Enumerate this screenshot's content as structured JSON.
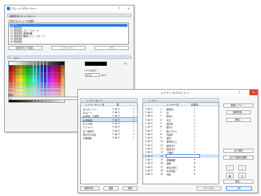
{
  "colors": {
    "accent": "#2f7fe0",
    "header_bg": "#dbe3ee",
    "close_red": "#e0413b",
    "row_selected": "#cfe3fb"
  },
  "win1": {
    "title": "パレットマネージャー",
    "help": "?",
    "close": "×",
    "section1": "画像形状パレットセット",
    "list_label": "下記からパレットを選択",
    "items": [
      "モデル",
      "01 電気設計",
      "02 電気設計_グレースケール",
      "03 電気設計_機械設備",
      "04 電気設計(機械)_グレースケール",
      "05 電気設計",
      "06 電気設計"
    ],
    "btn_save": "名前を付けて保存...",
    "btn_rename": "名前の変更...",
    "btn_delete": "削除",
    "section2": "カラー",
    "pen_width_label": "ペンの太さ:",
    "pen_width_value": "0.13",
    "pen_width_unit": "mm",
    "pen_number": "21",
    "pen_desc_label": "説明:",
    "pen_desc_value": "ペ"
  },
  "win2": {
    "title": "レイヤー(モデルビュー)",
    "help": "?",
    "close": "×",
    "left_tab": "レイヤーセット",
    "right_tab": "レイヤー",
    "left_col_name": "レイヤーセット名",
    "left_col_2": "表",
    "right_col_name": "レイヤー名",
    "right_col_num": "拡張名",
    "left_rows": [
      {
        "name": "全てのレイヤー",
        "n": "1"
      },
      {
        "name": "ALボード",
        "n": "1"
      },
      {
        "name": "AL断面・立面図",
        "n": "1"
      },
      {
        "name": "AL配置図",
        "n": "1"
      },
      {
        "name": "ALその他",
        "n": "1"
      },
      {
        "name": "デフォルト",
        "n": "1"
      },
      {
        "name": "全て使用中",
        "n": "1"
      },
      {
        "name": "表示中の名前",
        "n": "1"
      },
      {
        "name": "平面図面",
        "n": "1"
      }
    ],
    "right_rows": [
      {
        "num": "1",
        "name": "基準図",
        "ext": "1"
      },
      {
        "num": "2",
        "name": "柱",
        "ext": "1"
      },
      {
        "num": "3",
        "name": "壁(外)",
        "ext": "1"
      },
      {
        "num": "4",
        "name": "天井",
        "ext": "1"
      },
      {
        "num": "5",
        "name": "建具枠",
        "ext": "1"
      },
      {
        "num": "6",
        "name": "壁(内)",
        "ext": "1"
      },
      {
        "num": "7",
        "name": "壁(パネル)",
        "ext": "1"
      },
      {
        "num": "8",
        "name": "内装材",
        "ext": "1"
      },
      {
        "num": "9",
        "name": "家具",
        "ext": "1"
      },
      {
        "num": "10",
        "name": "壁(壁仕上)",
        "ext": "1"
      },
      {
        "num": "11",
        "name": "建具(外)",
        "ext": "1"
      },
      {
        "num": "12",
        "name": "建具(内)",
        "ext": "1"
      },
      {
        "num": "13",
        "name": "三面図",
        "ext": "1"
      },
      {
        "num": "14",
        "name": "階",
        "ext": "1"
      },
      {
        "num": "15",
        "name": "設備機器",
        "ext": "8"
      },
      {
        "num": "16",
        "name": "設備",
        "ext": "8"
      },
      {
        "num": "17",
        "name": "家具(形状)",
        "ext": "8"
      },
      {
        "num": "18",
        "name": "天井伏図",
        "ext": "8"
      },
      {
        "num": "19",
        "name": "外部",
        "ext": "8"
      }
    ],
    "side_btn_new_layer": "新規レイヤー...",
    "side_btn_new_layer2": "新規作成...",
    "side_btn_delete": "削除...",
    "side_btn_select_all": "全て選択",
    "side_btn_show_all": "全ての選択を解除",
    "side_btn_extra": "設定...",
    "bottom_new": "新規作成...",
    "bottom_update": "更新",
    "bottom_delete": "削除",
    "cancel": "キャンセル",
    "ok": "OK"
  }
}
